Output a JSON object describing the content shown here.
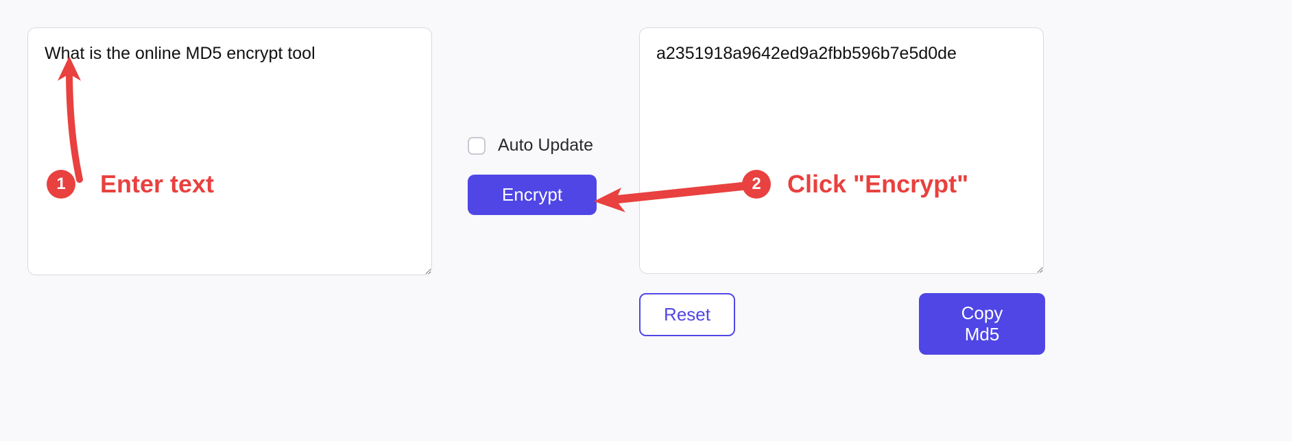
{
  "input": {
    "value": "What is the online MD5 encrypt tool"
  },
  "output": {
    "value": "a2351918a9642ed9a2fbb596b7e5d0de"
  },
  "controls": {
    "auto_update_label": "Auto Update",
    "encrypt_label": "Encrypt",
    "reset_label": "Reset",
    "copy_label": "Copy Md5"
  },
  "annotations": {
    "step1_number": "1",
    "step1_text": "Enter text",
    "step2_number": "2",
    "step2_text": "Click \"Encrypt\""
  }
}
